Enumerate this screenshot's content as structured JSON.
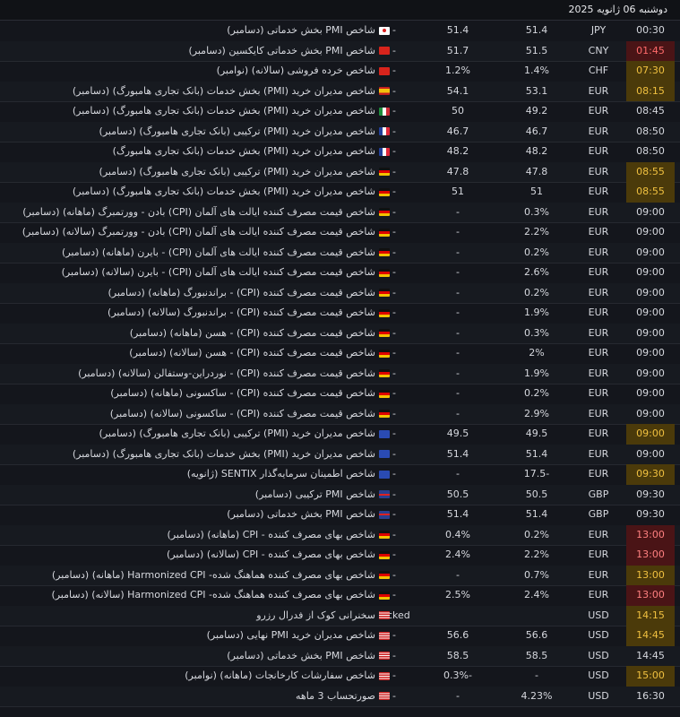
{
  "header": {
    "date": "دوشنبه 06 ژانویه 2025"
  },
  "rows": [
    {
      "time": "00:30",
      "hl": "",
      "cur": "JPY",
      "act": "51.4",
      "fct": "51.4",
      "prv": "-",
      "flag": "jp",
      "event": "شاخص PMI بخش خدماتی (دسامبر)"
    },
    {
      "time": "01:45",
      "hl": "hl-red",
      "cur": "CNY",
      "act": "51.5",
      "fct": "51.7",
      "prv": "-",
      "flag": "cn",
      "event": "شاخص PMI بخش خدماتی کایکسین (دسامبر)"
    },
    {
      "time": "07:30",
      "hl": "hl-yel",
      "cur": "CHF",
      "act": "1.4%",
      "fct": "1.2%",
      "prv": "-",
      "flag": "ch",
      "event": "شاخص خرده فروشی (سالانه) (نوامبر)"
    },
    {
      "time": "08:15",
      "hl": "hl-yel",
      "cur": "EUR",
      "act": "53.1",
      "fct": "54.1",
      "prv": "-",
      "flag": "es",
      "event": "شاخص مدیران خرید (PMI) بخش خدمات (بانک تجاری هامبورگ) (دسامبر)"
    },
    {
      "time": "08:45",
      "hl": "",
      "cur": "EUR",
      "act": "49.2",
      "fct": "50",
      "prv": "-",
      "flag": "it",
      "event": "شاخص مدیران خرید (PMI) بخش خدمات (بانک تجاری هامبورگ) (دسامبر)"
    },
    {
      "time": "08:50",
      "hl": "",
      "cur": "EUR",
      "act": "46.7",
      "fct": "46.7",
      "prv": "-",
      "flag": "fr",
      "event": "شاخص مدیران خرید (PMI) ترکیبی (بانک تجاری هامبورگ) (دسامبر)"
    },
    {
      "time": "08:50",
      "hl": "",
      "cur": "EUR",
      "act": "48.2",
      "fct": "48.2",
      "prv": "-",
      "flag": "fr",
      "event": "شاخص مدیران خرید (PMI) بخش خدمات (بانک تجاری هامبورگ)"
    },
    {
      "time": "08:55",
      "hl": "hl-yel",
      "cur": "EUR",
      "act": "47.8",
      "fct": "47.8",
      "prv": "-",
      "flag": "de",
      "event": "شاخص مدیران خرید (PMI) ترکیبی (بانک تجاری هامبورگ) (دسامبر)"
    },
    {
      "time": "08:55",
      "hl": "hl-yel",
      "cur": "EUR",
      "act": "51",
      "fct": "51",
      "prv": "-",
      "flag": "de",
      "event": "شاخص مدیران خرید (PMI) بخش خدمات (بانک تجاری هامبورگ) (دسامبر)"
    },
    {
      "time": "09:00",
      "hl": "",
      "cur": "EUR",
      "act": "0.3%",
      "fct": "-",
      "prv": "-",
      "flag": "de",
      "event": "شاخص قیمت مصرف کننده ایالت های آلمان (CPI) بادن - وورتمبرگ (ماهانه) (دسامبر)"
    },
    {
      "time": "09:00",
      "hl": "",
      "cur": "EUR",
      "act": "2.2%",
      "fct": "-",
      "prv": "-",
      "flag": "de",
      "event": "شاخص قیمت مصرف کننده ایالت های آلمان (CPI) بادن - وورتمبرگ (سالانه) (دسامبر)"
    },
    {
      "time": "09:00",
      "hl": "",
      "cur": "EUR",
      "act": "0.2%",
      "fct": "-",
      "prv": "-",
      "flag": "de",
      "event": "شاخص قیمت مصرف کننده ایالت های آلمان (CPI) - بایرن (ماهانه) (دسامبر)"
    },
    {
      "time": "09:00",
      "hl": "",
      "cur": "EUR",
      "act": "2.6%",
      "fct": "-",
      "prv": "-",
      "flag": "de",
      "event": "شاخص قیمت مصرف کننده ایالت های آلمان (CPI) - بایرن (سالانه) (دسامبر)"
    },
    {
      "time": "09:00",
      "hl": "",
      "cur": "EUR",
      "act": "0.2%",
      "fct": "-",
      "prv": "-",
      "flag": "de",
      "event": "شاخص قیمت مصرف کننده (CPI) - براندنبورگ (ماهانه) (دسامبر)"
    },
    {
      "time": "09:00",
      "hl": "",
      "cur": "EUR",
      "act": "1.9%",
      "fct": "-",
      "prv": "-",
      "flag": "de",
      "event": "شاخص قیمت مصرف کننده (CPI) - براندنبورگ (سالانه) (دسامبر)"
    },
    {
      "time": "09:00",
      "hl": "",
      "cur": "EUR",
      "act": "0.3%",
      "fct": "-",
      "prv": "-",
      "flag": "de",
      "event": "شاخص قیمت مصرف کننده (CPI) - هسن (ماهانه) (دسامبر)"
    },
    {
      "time": "09:00",
      "hl": "",
      "cur": "EUR",
      "act": "2%",
      "fct": "-",
      "prv": "-",
      "flag": "de",
      "event": "شاخص قیمت مصرف کننده (CPI) - هسن (سالانه) (دسامبر)"
    },
    {
      "time": "09:00",
      "hl": "",
      "cur": "EUR",
      "act": "1.9%",
      "fct": "-",
      "prv": "-",
      "flag": "de",
      "event": "شاخص قیمت مصرف کننده (CPI) - نوردراین-وستفالن (سالانه) (دسامبر)"
    },
    {
      "time": "09:00",
      "hl": "",
      "cur": "EUR",
      "act": "0.2%",
      "fct": "-",
      "prv": "-",
      "flag": "de",
      "event": "شاخص قیمت مصرف کننده (CPI) - ساکسونی (ماهانه) (دسامبر)"
    },
    {
      "time": "09:00",
      "hl": "",
      "cur": "EUR",
      "act": "2.9%",
      "fct": "-",
      "prv": "-",
      "flag": "de",
      "event": "شاخص قیمت مصرف کننده (CPI) - ساکسونی (سالانه) (دسامبر)"
    },
    {
      "time": "09:00",
      "hl": "hl-yel",
      "cur": "EUR",
      "act": "49.5",
      "fct": "49.5",
      "prv": "-",
      "flag": "eu",
      "event": "شاخص مدیران خرید (PMI) ترکیبی (بانک تجاری هامبورگ) (دسامبر)"
    },
    {
      "time": "09:00",
      "hl": "",
      "cur": "EUR",
      "act": "51.4",
      "fct": "51.4",
      "prv": "-",
      "flag": "eu",
      "event": "شاخص مدیران خرید (PMI) بخش خدمات (بانک تجاری هامبورگ) (دسامبر)"
    },
    {
      "time": "09:30",
      "hl": "hl-yel",
      "cur": "EUR",
      "act": "17.5-",
      "fct": "-",
      "prv": "-",
      "flag": "eu",
      "event": "شاخص اطمینان سرمایه‌گذار SENTIX (ژانویه)"
    },
    {
      "time": "09:30",
      "hl": "",
      "cur": "GBP",
      "act": "50.5",
      "fct": "50.5",
      "prv": "-",
      "flag": "uk",
      "event": "شاخص PMI ترکیبی (دسامبر)"
    },
    {
      "time": "09:30",
      "hl": "",
      "cur": "GBP",
      "act": "51.4",
      "fct": "51.4",
      "prv": "-",
      "flag": "uk",
      "event": "شاخص PMI بخش خدماتی (دسامبر)"
    },
    {
      "time": "13:00",
      "hl": "hl-red2",
      "cur": "EUR",
      "act": "0.2%",
      "fct": "0.4%",
      "prv": "-",
      "flag": "de",
      "event": "شاخص بهای مصرف کننده - CPI (ماهانه) (دسامبر)"
    },
    {
      "time": "13:00",
      "hl": "hl-red2",
      "cur": "EUR",
      "act": "2.2%",
      "fct": "2.4%",
      "prv": "-",
      "flag": "de",
      "event": "شاخص بهای مصرف کننده - CPI (سالانه) (دسامبر)"
    },
    {
      "time": "13:00",
      "hl": "hl-yel",
      "cur": "EUR",
      "act": "0.7%",
      "fct": "-",
      "prv": "-",
      "flag": "de",
      "event": "شاخص بهای مصرف کننده هماهنگ شده- Harmonized CPI (ماهانه) (دسامبر)"
    },
    {
      "time": "13:00",
      "hl": "hl-red2",
      "cur": "EUR",
      "act": "2.4%",
      "fct": "2.5%",
      "prv": "-",
      "flag": "de",
      "event": "شاخص بهای مصرف کننده هماهنگ شده- Harmonized CPI (سالانه) (دسامبر)"
    },
    {
      "time": "14:15",
      "hl": "hl-yel",
      "cur": "USD",
      "act": "",
      "fct": "",
      "prv": "locked",
      "flag": "us",
      "event": "سخنرانی کوک از فدرال رزرو"
    },
    {
      "time": "14:45",
      "hl": "hl-yel",
      "cur": "USD",
      "act": "56.6",
      "fct": "56.6",
      "prv": "-",
      "flag": "us",
      "event": "شاخص مدیران خرید PMI نهایی (دسامبر)"
    },
    {
      "time": "14:45",
      "hl": "",
      "cur": "USD",
      "act": "58.5",
      "fct": "58.5",
      "prv": "-",
      "flag": "us",
      "event": "شاخص PMI بخش خدماتی (دسامبر)"
    },
    {
      "time": "15:00",
      "hl": "hl-yel",
      "cur": "USD",
      "act": "-",
      "fct": "0.3%-",
      "prv": "-",
      "flag": "us",
      "event": "شاخص سفارشات کارخانجات (ماهانه) (نوامبر)"
    },
    {
      "time": "16:30",
      "hl": "",
      "cur": "USD",
      "act": "4.23%",
      "fct": "-",
      "prv": "-",
      "flag": "us",
      "event": "صورتحساب 3 ماهه"
    }
  ]
}
